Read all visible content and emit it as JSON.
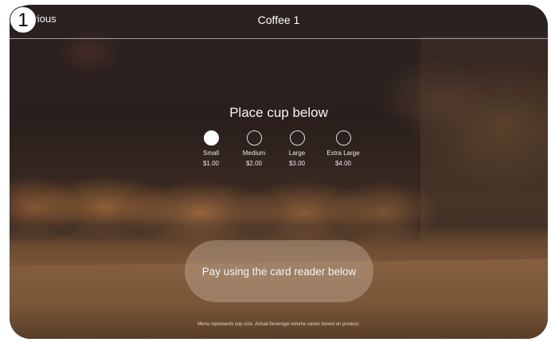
{
  "step_badge": "1",
  "header": {
    "previous_label": "Previous",
    "title": "Coffee 1"
  },
  "main": {
    "heading": "Place cup below",
    "sizes": [
      {
        "name": "Small",
        "price": "$1.00",
        "selected": true
      },
      {
        "name": "Medium",
        "price": "$2.00",
        "selected": false
      },
      {
        "name": "Large",
        "price": "$3.00",
        "selected": false
      },
      {
        "name": "Extra Large",
        "price": "$4.00",
        "selected": false
      }
    ],
    "pay_label": "Pay using the card reader below",
    "footnote": "Menu represents cup size. Actual beverage volume varies based on product."
  },
  "colors": {
    "accent": "#ffffff",
    "background": "#2a1f1c"
  }
}
